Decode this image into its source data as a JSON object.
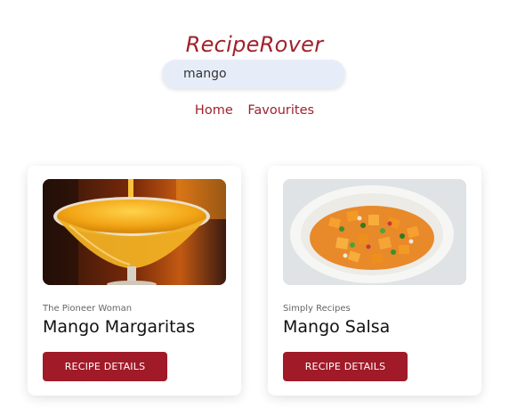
{
  "app": {
    "title": "RecipeRover"
  },
  "search": {
    "value": "mango"
  },
  "nav": {
    "home": "Home",
    "favourites": "Favourites"
  },
  "recipes": [
    {
      "source": "The Pioneer Woman",
      "title": "Mango Margaritas",
      "button": "RECIPE DETAILS"
    },
    {
      "source": "Simply Recipes",
      "title": "Mango Salsa",
      "button": "RECIPE DETAILS"
    }
  ],
  "colors": {
    "brand": "#a0222b",
    "button_bg": "#a01a28",
    "search_bg": "#e7edf8"
  }
}
